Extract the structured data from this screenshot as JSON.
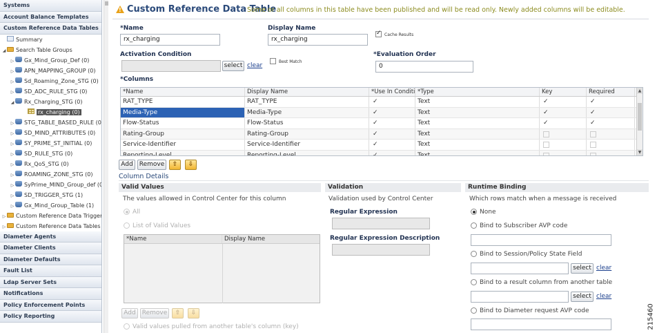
{
  "nav": {
    "items": [
      {
        "type": "header",
        "label": "Systems"
      },
      {
        "type": "header",
        "label": "Account Balance Templates"
      },
      {
        "type": "header",
        "label": "Custom Reference Data Tables"
      },
      {
        "type": "leaf",
        "label": "Summary",
        "indent": 1,
        "icon": "summary"
      },
      {
        "type": "folder",
        "label": "Search Table Groups",
        "indent": 1,
        "toggle": "▲"
      },
      {
        "type": "db",
        "label": "Gx_Mind_Group_Def (0)",
        "indent": 2,
        "toggle": "▷"
      },
      {
        "type": "db",
        "label": "APN_MAPPING_GROUP (0)",
        "indent": 2,
        "toggle": "▷"
      },
      {
        "type": "db",
        "label": "Sd_Roaming_Zone_STG (0)",
        "indent": 2,
        "toggle": "▷"
      },
      {
        "type": "db",
        "label": "SD_ADC_RULE_STG (0)",
        "indent": 2,
        "toggle": "▷"
      },
      {
        "type": "db",
        "label": "Rx_Charging_STG (0)",
        "indent": 2,
        "toggle": "▲"
      },
      {
        "type": "grid",
        "label": "rx_charging (0)",
        "indent": 3,
        "selected": true
      },
      {
        "type": "db",
        "label": "STG_TABLE_BASED_RULE (0)",
        "indent": 2,
        "toggle": "▷"
      },
      {
        "type": "db",
        "label": "SD_MIND_ATTRIBUTES (0)",
        "indent": 2,
        "toggle": "▷"
      },
      {
        "type": "db",
        "label": "SY_PRIME_ST_INITIAL (0)",
        "indent": 2,
        "toggle": "▷"
      },
      {
        "type": "db",
        "label": "SD_RULE_STG (0)",
        "indent": 2,
        "toggle": "▷"
      },
      {
        "type": "db",
        "label": "Rx_QoS_STG (0)",
        "indent": 2,
        "toggle": "▷"
      },
      {
        "type": "db",
        "label": "ROAMING_ZONE_STG (0)",
        "indent": 2,
        "toggle": "▷"
      },
      {
        "type": "db",
        "label": "SyPrime_MIND_Group_def (0",
        "indent": 2,
        "toggle": "▷"
      },
      {
        "type": "db",
        "label": "SD_TRIGGER_STG (1)",
        "indent": 2,
        "toggle": "▷"
      },
      {
        "type": "db",
        "label": "Gx_Mind_Group_Table (1)",
        "indent": 2,
        "toggle": "▷"
      },
      {
        "type": "folder",
        "label": "Custom Reference Data Trigger",
        "indent": 1,
        "toggle": "▷"
      },
      {
        "type": "folder",
        "label": "Custom Reference Data Tables",
        "indent": 1,
        "toggle": "▷"
      },
      {
        "type": "header",
        "label": "Diameter Agents"
      },
      {
        "type": "header",
        "label": "Diameter Clients"
      },
      {
        "type": "header",
        "label": "Diameter Defaults"
      },
      {
        "type": "header",
        "label": "Fault List"
      },
      {
        "type": "header",
        "label": "Ldap Server Sets"
      },
      {
        "type": "header",
        "label": "Notifications"
      },
      {
        "type": "header",
        "label": "Policy Enforcement Points"
      },
      {
        "type": "header",
        "label": "Policy Reporting"
      }
    ]
  },
  "header": {
    "title": "Custom Reference Data Table",
    "message": "Some or all columns in this table have been published and will be read only. Newly added columns will be editable."
  },
  "form": {
    "name_label": "*Name",
    "name_value": "rx_charging",
    "display_name_label": "Display Name",
    "display_name_value": "rx_charging",
    "cache_results_label": "Cache Results",
    "cache_results_checked": true,
    "activation_label": "Activation Condition",
    "activation_value": "",
    "select_label": "select",
    "clear_label": "clear",
    "best_match_label": "Best Match",
    "best_match_checked": false,
    "eval_order_label": "*Evaluation Order",
    "eval_order_value": "0"
  },
  "columns": {
    "label": "*Columns",
    "headers": [
      "*Name",
      "Display Name",
      "*Use In Conditi",
      "*Type",
      "Key",
      "Required"
    ],
    "rows": [
      {
        "name": "RAT_TYPE",
        "display": "RAT_TYPE",
        "use": true,
        "type": "Text",
        "key": true,
        "required": true
      },
      {
        "name": "Media-Type",
        "display": "Media-Type",
        "use": true,
        "type": "Text",
        "key": true,
        "required": true,
        "selected": true
      },
      {
        "name": "Flow-Status",
        "display": "Flow-Status",
        "use": true,
        "type": "Text",
        "key": true,
        "required": true
      },
      {
        "name": "Rating-Group",
        "display": "Rating-Group",
        "use": true,
        "type": "Text",
        "key": false,
        "required": false
      },
      {
        "name": "Service-Identifier",
        "display": "Service-Identifier",
        "use": true,
        "type": "Text",
        "key": false,
        "required": false
      },
      {
        "name": "Reporting-Level",
        "display": "Reporting-Level",
        "use": true,
        "type": "Text",
        "key": false,
        "required": false
      }
    ],
    "add_label": "Add",
    "remove_label": "Remove"
  },
  "details": {
    "section_label": "Column Details",
    "valid_values": {
      "title": "Valid Values",
      "desc": "The values allowed in Control Center for this column",
      "opt_all": "All",
      "opt_list": "List of Valid Values",
      "grid_headers": [
        "*Name",
        "Display Name"
      ],
      "add_label": "Add",
      "remove_label": "Remove",
      "opt_pulled": "Valid values pulled from another table's column (key)"
    },
    "validation": {
      "title": "Validation",
      "desc": "Validation used by Control Center",
      "regex_label": "Regular Expression",
      "regex_value": "",
      "regex_desc_label": "Regular Expression Description",
      "regex_desc_value": ""
    },
    "runtime": {
      "title": "Runtime Binding",
      "desc": "Which rows match when a message is received",
      "opt_none": "None",
      "opt_subscriber": "Bind to Subscriber AVP code",
      "opt_session": "Bind to Session/Policy State Field",
      "opt_result": "Bind to a result column from another table",
      "opt_diameter": "Bind to Diameter request AVP code",
      "select_label": "select",
      "clear_label": "clear"
    }
  },
  "figure_id": "215460"
}
